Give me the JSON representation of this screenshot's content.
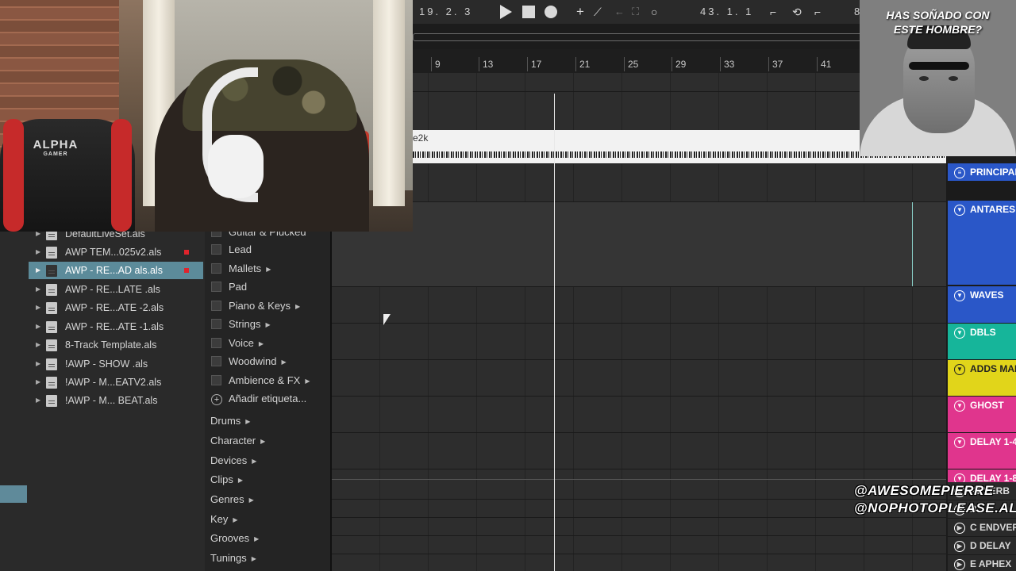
{
  "webcam": {
    "chair_brand": "ALPHA",
    "chair_sub": "GAMER"
  },
  "transport": {
    "position": "19. 2. 3",
    "loop_start": "43. 1. 1",
    "partial": "8"
  },
  "ruler": {
    "bars": [
      "9",
      "13",
      "17",
      "21",
      "25",
      "29",
      "33",
      "37",
      "41"
    ]
  },
  "clip": {
    "name": "e2k"
  },
  "browser": {
    "files": [
      {
        "name": "DefaultLiveSet.als",
        "dot": false,
        "active": false
      },
      {
        "name": "AWP TEM...025v2.als",
        "dot": true,
        "active": false
      },
      {
        "name": "AWP - RE...AD als.als",
        "dot": true,
        "active": true
      },
      {
        "name": "AWP - RE...LATE .als",
        "dot": false,
        "active": false
      },
      {
        "name": "AWP - RE...ATE -2.als",
        "dot": false,
        "active": false
      },
      {
        "name": "AWP - RE...ATE -1.als",
        "dot": false,
        "active": false
      },
      {
        "name": "8-Track Template.als",
        "dot": false,
        "active": false
      },
      {
        "name": "!AWP - SHOW .als",
        "dot": false,
        "active": false
      },
      {
        "name": "!AWP - M...EATV2.als",
        "dot": false,
        "active": false
      },
      {
        "name": "!AWP - M... BEAT.als",
        "dot": false,
        "active": false
      }
    ],
    "tags": [
      {
        "label": "Guitar & Plucked",
        "checkbox": true,
        "arrow": false
      },
      {
        "label": "Lead",
        "checkbox": true,
        "arrow": false
      },
      {
        "label": "Mallets",
        "checkbox": true,
        "arrow": true
      },
      {
        "label": "Pad",
        "checkbox": true,
        "arrow": false
      },
      {
        "label": "Piano & Keys",
        "checkbox": true,
        "arrow": true
      },
      {
        "label": "Strings",
        "checkbox": true,
        "arrow": true
      },
      {
        "label": "Voice",
        "checkbox": true,
        "arrow": true
      },
      {
        "label": "Woodwind",
        "checkbox": true,
        "arrow": true
      },
      {
        "label": "Ambience & FX",
        "checkbox": true,
        "arrow": true
      },
      {
        "label": "Añadir etiqueta...",
        "checkbox": false,
        "arrow": false,
        "plus": true
      }
    ],
    "categories": [
      "Drums",
      "Character",
      "Devices",
      "Clips",
      "Genres",
      "Key",
      "Grooves",
      "Tunings"
    ]
  },
  "tracks": [
    {
      "name": "PRINCIPAL",
      "color": "#2a57c8"
    },
    {
      "name": "ANTARES",
      "color": "#2a57c8"
    },
    {
      "name": "WAVES",
      "color": "#2a57c8"
    },
    {
      "name": "DBLS",
      "color": "#16b59a"
    },
    {
      "name": "ADDS MAIN",
      "color": "#e1d51a"
    },
    {
      "name": "GHOST",
      "color": "#e0358d"
    },
    {
      "name": "DELAY 1-4",
      "color": "#e0358d"
    },
    {
      "name": "DELAY 1-8",
      "color": "#e0358d"
    },
    {
      "name": "REVERB",
      "color": "#2a2a2a"
    },
    {
      "name": "B",
      "color": "#2a2a2a"
    },
    {
      "name": "C ENDVERB",
      "color": "#2a2a2a"
    },
    {
      "name": "D DELAY",
      "color": "#2a2a2a"
    },
    {
      "name": "E APHEX",
      "color": "#2a2a2a"
    }
  ],
  "promo": {
    "caption_line1": "HAS SOÑADO CON",
    "caption_line2": "ESTE HOMBRE?"
  },
  "handles": {
    "line1": "@AWESOMEPIERRE",
    "line2": "@NOPHOTOPLEASE.ALS"
  }
}
